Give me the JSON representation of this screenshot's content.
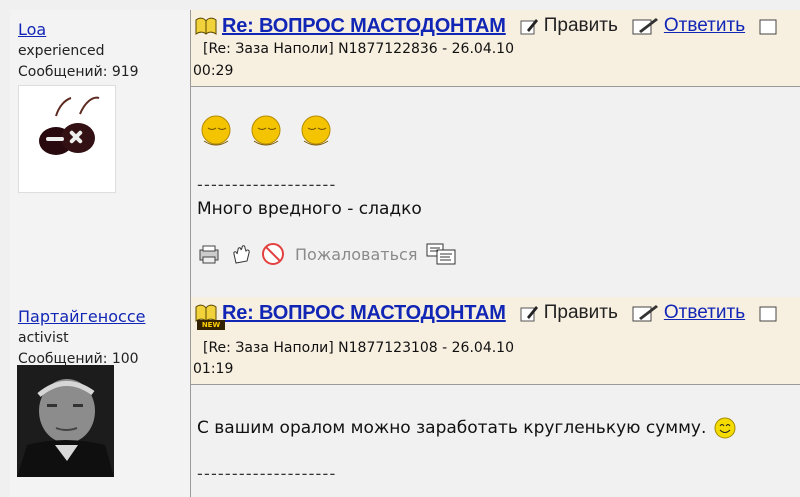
{
  "posts": [
    {
      "author": "Loa",
      "role": "experienced",
      "message_count": "Сообщений: 919",
      "title": "Re: ВОПРОС МАСТОДОНТАМ",
      "edit_label": "Править",
      "reply_label": "Ответить",
      "meta_line1": "[Re: Заза Наполи]  N1877122836 - 26.04.10",
      "meta_line2": "00:29",
      "separator": "--------------------",
      "text": "Много вредного - сладко",
      "report_label": "Пожаловаться"
    },
    {
      "author": "Партайгеноссе",
      "role": "activist",
      "message_count": "Сообщений: 100",
      "new_badge": "NEW",
      "title": "Re: ВОПРОС МАСТОДОНТАМ",
      "edit_label": "Править",
      "reply_label": "Ответить",
      "meta_line1": "[Re: Заза Наполи]  N1877123108 - 26.04.10",
      "meta_line2": "01:19",
      "text": "С вашим оралом можно заработать кругленькую сумму.",
      "separator": "--------------------"
    }
  ],
  "icons": {
    "book": "book-icon",
    "edit": "edit-pencil-icon",
    "reply": "reply-pen-icon",
    "print": "printer-icon",
    "hand": "hand-icon",
    "report": "forbidden-icon",
    "quote": "quote-icon",
    "smiley": "smiley-icon"
  },
  "colors": {
    "link": "#1226b5",
    "header_bg": "#f7efe0",
    "body_bg": "#f1f1f1"
  }
}
